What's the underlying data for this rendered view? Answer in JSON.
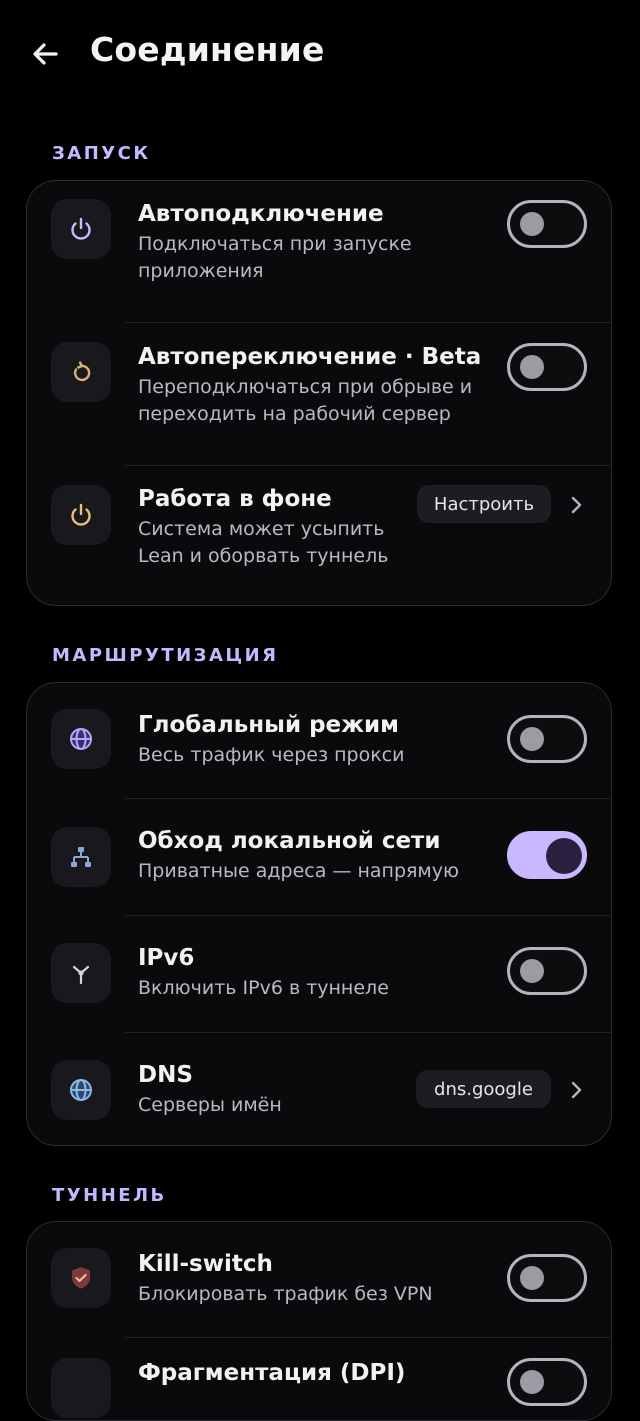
{
  "header": {
    "title": "Соединение",
    "back_icon": "arrow-left-icon"
  },
  "colors": {
    "accent": "#c9b8ff",
    "section_label": "#c8b6ff",
    "background": "#000000",
    "card": "#0a0a0d"
  },
  "sections": [
    {
      "label": "ЗАПУСК",
      "rows": [
        {
          "title": "Автоподключение",
          "subtitle_lines": [
            "Подключаться при запуске",
            "приложения"
          ],
          "icon": "power-icon",
          "control": "toggle",
          "on": false
        },
        {
          "title": "Автопереключение · Beta",
          "subtitle_lines": [
            "Переподключаться при обрыве и",
            "переходить на рабочий сервер"
          ],
          "icon": "rotate-icon",
          "control": "toggle",
          "on": false
        },
        {
          "title": "Работа в фоне",
          "subtitle_lines": [
            "Система может усыпить",
            "Lean и оборвать туннель"
          ],
          "icon": "power-icon",
          "control": "button",
          "button_label": "Настроить"
        }
      ]
    },
    {
      "label": "МАРШРУТИЗАЦИЯ",
      "rows": [
        {
          "title": "Глобальный режим",
          "subtitle_lines": [
            "Весь трафик через прокси"
          ],
          "icon": "globe-icon",
          "control": "toggle",
          "on": false
        },
        {
          "title": "Обход локальной сети",
          "subtitle_lines": [
            "Приватные адреса — напрямую"
          ],
          "icon": "network-icon",
          "control": "toggle",
          "on": true
        },
        {
          "title": "IPv6",
          "subtitle_lines": [
            "Включить IPv6 в туннеле"
          ],
          "icon": "fork-icon",
          "control": "toggle",
          "on": false
        },
        {
          "title": "DNS",
          "subtitle_lines": [
            "Серверы имён"
          ],
          "icon": "globe-icon",
          "control": "button",
          "button_label": "dns.google"
        }
      ]
    },
    {
      "label": "ТУННЕЛЬ",
      "rows": [
        {
          "title": "Kill-switch",
          "subtitle_lines": [
            "Блокировать трафик без VPN"
          ],
          "icon": "shield-icon",
          "control": "toggle",
          "on": false
        },
        {
          "title": "Фрагментация (DPI)",
          "subtitle_lines": [],
          "icon": "fragment-icon",
          "control": "toggle",
          "on": false
        }
      ]
    }
  ]
}
